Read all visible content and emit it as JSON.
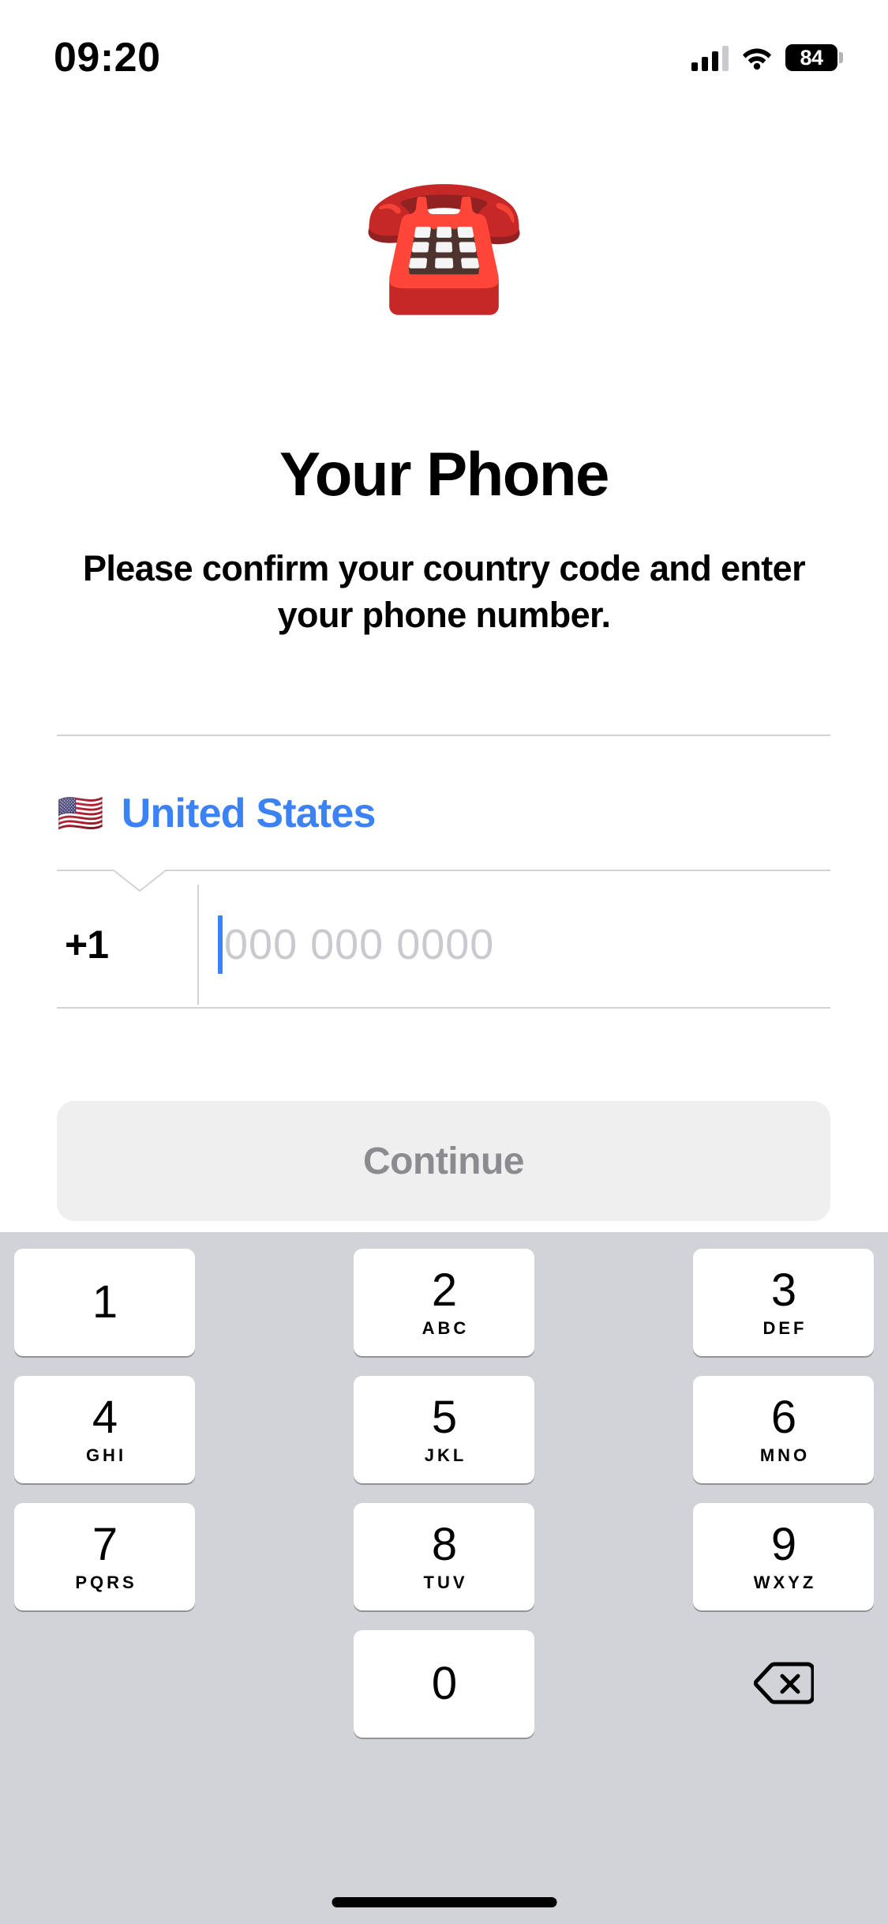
{
  "status_bar": {
    "time": "09:20",
    "signal_icon": "cellular-signal-icon",
    "wifi_icon": "wifi-icon",
    "battery_level": "84",
    "battery_icon": "battery-icon"
  },
  "hero": {
    "emoji": "☎️",
    "emoji_name": "telephone-emoji",
    "title": "Your Phone",
    "subtitle": "Please confirm your country code and enter your phone number."
  },
  "form": {
    "country": {
      "flag": "🇺🇸",
      "flag_name": "us-flag-icon",
      "name": "United States",
      "color": "#3b82f6"
    },
    "phone": {
      "dial_code": "+1",
      "value": "",
      "placeholder": "000 000 0000",
      "caret_color": "#3b82f6"
    }
  },
  "continue_button": {
    "label": "Continue",
    "enabled": false,
    "background": "#efeff0",
    "text_color": "#8b8b90"
  },
  "keypad": {
    "background": "#d1d3d8",
    "keys": [
      {
        "digit": "1",
        "letters": ""
      },
      {
        "digit": "2",
        "letters": "ABC"
      },
      {
        "digit": "3",
        "letters": "DEF"
      },
      {
        "digit": "4",
        "letters": "GHI"
      },
      {
        "digit": "5",
        "letters": "JKL"
      },
      {
        "digit": "6",
        "letters": "MNO"
      },
      {
        "digit": "7",
        "letters": "PQRS"
      },
      {
        "digit": "8",
        "letters": "TUV"
      },
      {
        "digit": "9",
        "letters": "WXYZ"
      },
      {
        "digit": "0",
        "letters": ""
      }
    ],
    "delete_key": "delete-icon"
  },
  "home_indicator": "home-indicator"
}
